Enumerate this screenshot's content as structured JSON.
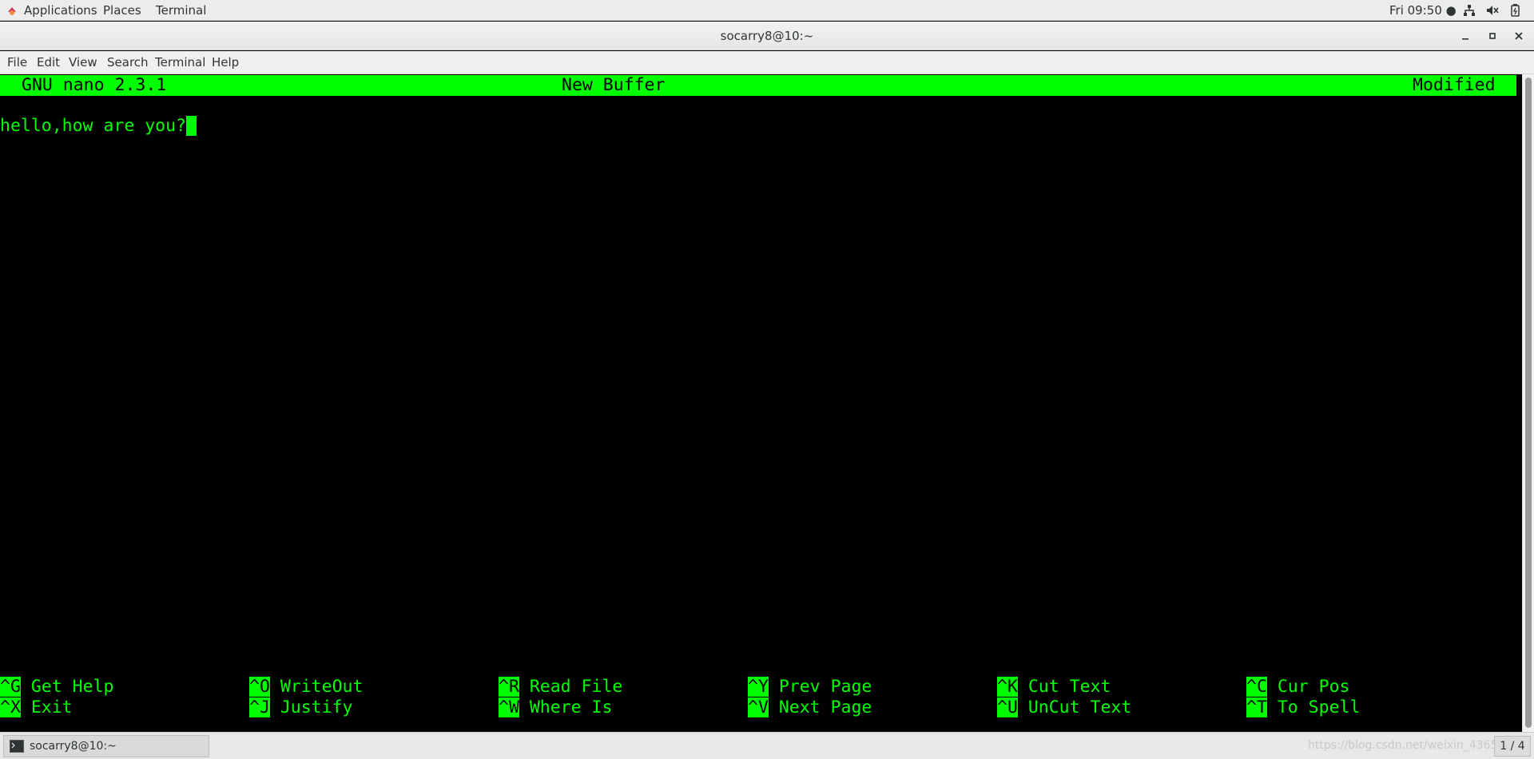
{
  "topbar": {
    "applications": "Applications",
    "places": "Places",
    "terminal": "Terminal",
    "clock": "Fri 09:50 ●",
    "icons": [
      "network-icon",
      "volume-icon",
      "battery-icon"
    ]
  },
  "window": {
    "title": "socarry8@10:~"
  },
  "menubar": {
    "items": [
      "File",
      "Edit",
      "View",
      "Search",
      "Terminal",
      "Help"
    ]
  },
  "nano": {
    "version": "GNU nano 2.3.1",
    "buffer": "New Buffer",
    "state": "Modified",
    "content": "hello,how are you?",
    "shortcuts_row1": [
      {
        "key": "^G",
        "label": "Get Help"
      },
      {
        "key": "^O",
        "label": "WriteOut"
      },
      {
        "key": "^R",
        "label": "Read File"
      },
      {
        "key": "^Y",
        "label": "Prev Page"
      },
      {
        "key": "^K",
        "label": "Cut Text"
      },
      {
        "key": "^C",
        "label": "Cur Pos"
      }
    ],
    "shortcuts_row2": [
      {
        "key": "^X",
        "label": "Exit"
      },
      {
        "key": "^J",
        "label": "Justify"
      },
      {
        "key": "^W",
        "label": "Where Is"
      },
      {
        "key": "^V",
        "label": "Next Page"
      },
      {
        "key": "^U",
        "label": "UnCut Text"
      },
      {
        "key": "^T",
        "label": "To Spell"
      }
    ],
    "colors": {
      "fg": "#00ff00",
      "bg": "#000000"
    }
  },
  "taskbar": {
    "window_label": "socarry8@10:~",
    "watermark": "https://blog.csdn.net/weixin_4365",
    "workspace": "1 / 4"
  }
}
